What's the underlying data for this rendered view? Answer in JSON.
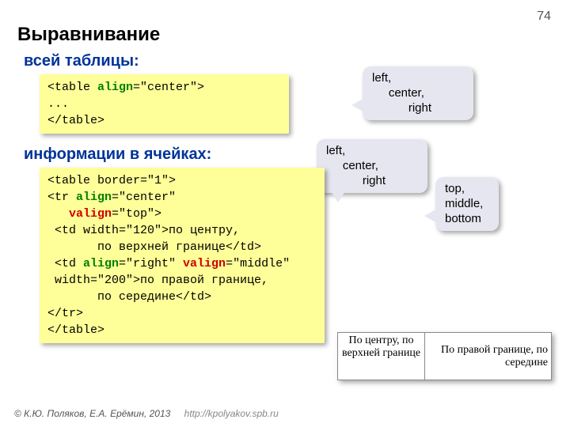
{
  "page_number": "74",
  "title": "Выравнивание",
  "subtitle1": "всей таблицы:",
  "subtitle2": "информации в ячейках:",
  "code1": {
    "l1a": "<table ",
    "l1attr": "align",
    "l1b": "=\"center\">",
    "l2": "...",
    "l3": "</table>"
  },
  "code2": {
    "l1": "<table border=\"1\">",
    "l2a": "<tr ",
    "l2attr": "align",
    "l2b": "=\"center\"",
    "l3a": "   ",
    "l3attr": "valign",
    "l3b": "=\"top\">",
    "l4": " <td width=\"120\">по центру,",
    "l5": "       по верхней границе</td>",
    "l6a": " <td ",
    "l6attr1": "align",
    "l6m": "=\"right\" ",
    "l6attr2": "valign",
    "l6b": "=\"middle\"",
    "l7": " width=\"200\">по правой границе,",
    "l8": "       по середине</td>",
    "l9": "</tr>",
    "l10": "</table>"
  },
  "callout1": {
    "l1": "left,",
    "l2": "     center,",
    "l3": "           right"
  },
  "callout2": {
    "l1": "left,",
    "l2": "     center,",
    "l3": "           right"
  },
  "callout3": {
    "l1": "top,",
    "l2": "middle,",
    "l3": "bottom"
  },
  "demo": {
    "c1": "По центру, по верхней границе",
    "c2": "По правой границе, по середине"
  },
  "footer": {
    "copyright": "© К.Ю. Поляков, Е.А. Ерёмин, 2013",
    "url": "http://kpolyakov.spb.ru"
  }
}
